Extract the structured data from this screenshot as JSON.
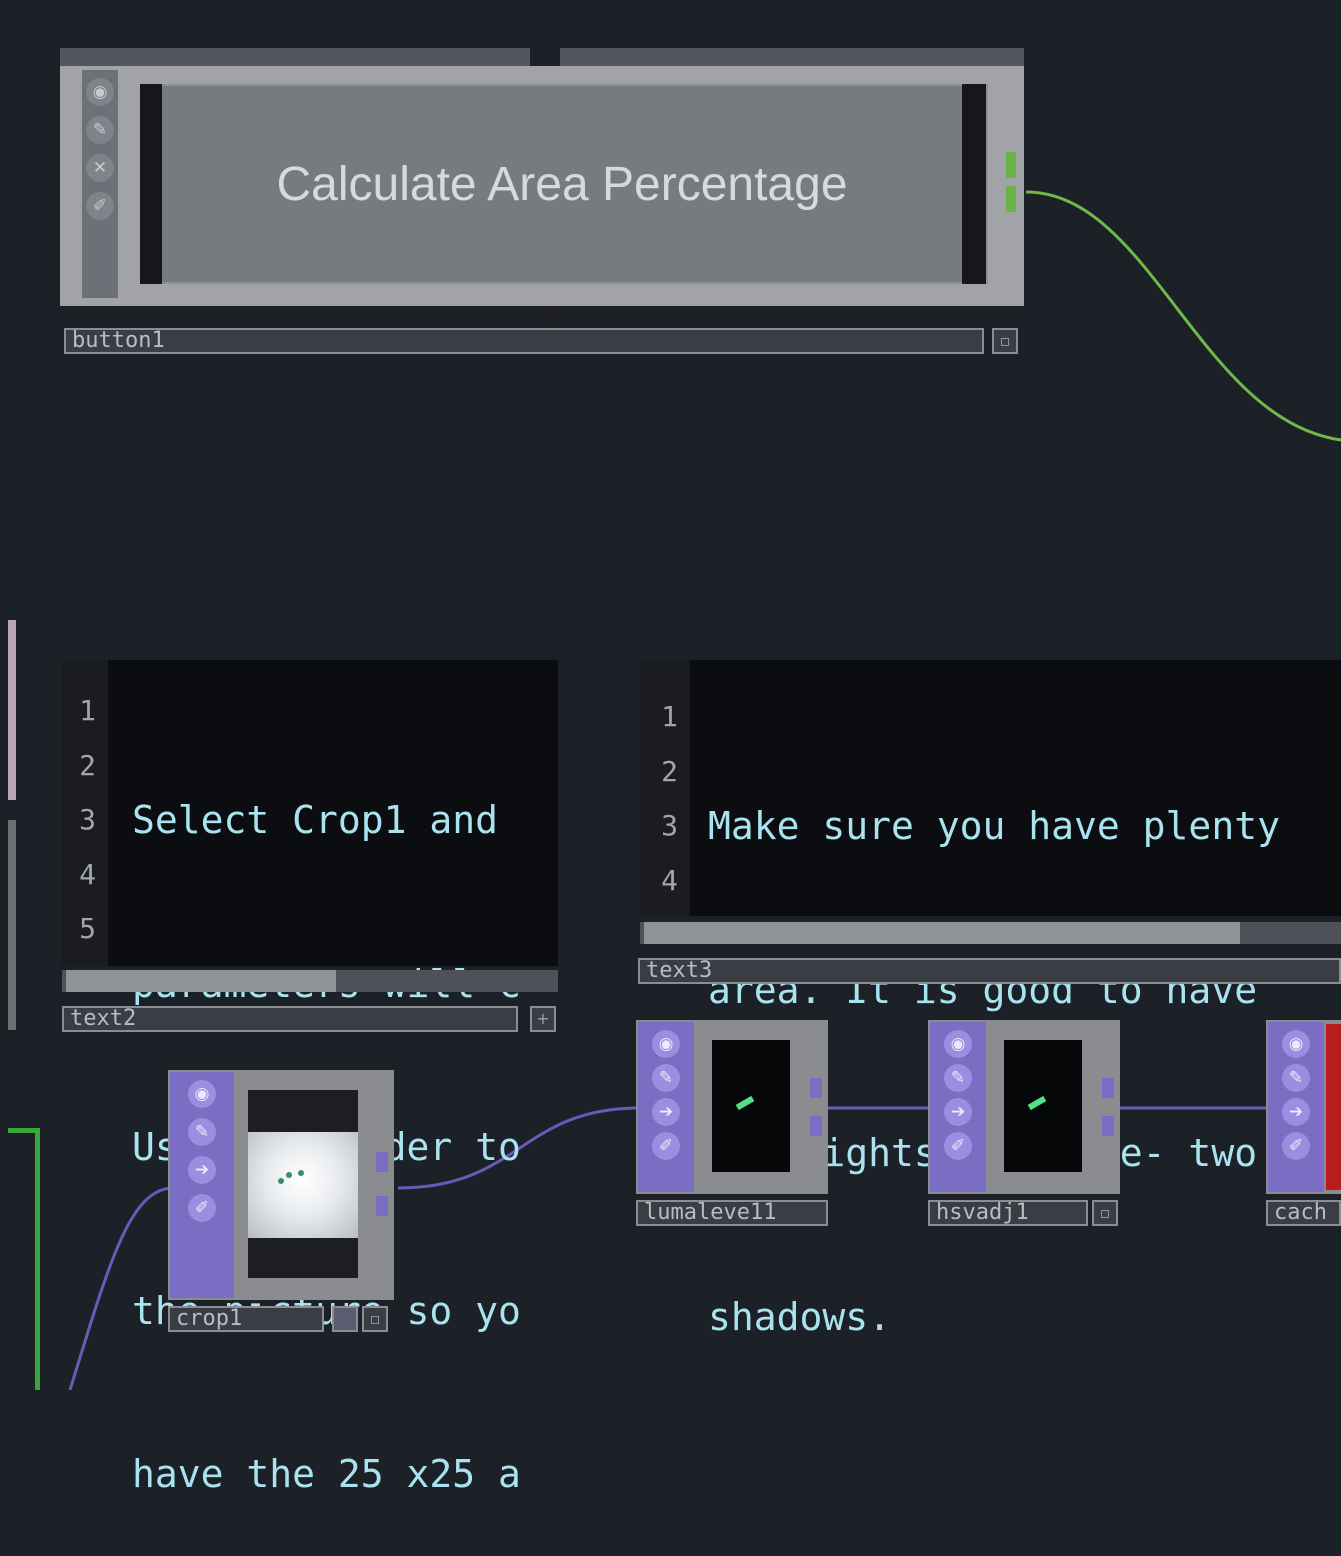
{
  "button_node": {
    "label": "Calculate Area Percentage",
    "name": "button1",
    "icons": [
      "info-icon",
      "pin-icon",
      "close-icon",
      "edit-icon"
    ],
    "wire_color": "#6fb94a"
  },
  "text2": {
    "name": "text2",
    "line_numbers": [
      "1",
      "2",
      "3",
      "4",
      "5"
    ],
    "lines": [
      "Select Crop1 and",
      "parameters will c",
      "Use the slider to",
      "the picture so yo",
      "have the 25 x25 a"
    ]
  },
  "text3": {
    "name": "text3",
    "line_numbers": [
      "1",
      "2",
      "3",
      "4"
    ],
    "lines": [
      "Make sure you have plenty",
      "area. It is good to have",
      "Desklights are fine- two",
      "shadows."
    ]
  },
  "top_nodes": {
    "crop": {
      "name": "crop1"
    },
    "lumalevel": {
      "name": "lumaleve11"
    },
    "hsvadjust": {
      "name": "hsvadj1"
    },
    "cache": {
      "name": "cach"
    },
    "wire_color": "#6a5ab8"
  },
  "colors": {
    "background": "#1c2027",
    "text_color": "#a9e3ef",
    "top_family": "#7b6cc4",
    "cache_red": "#b81c1c",
    "chop_green": "#39a83c"
  }
}
